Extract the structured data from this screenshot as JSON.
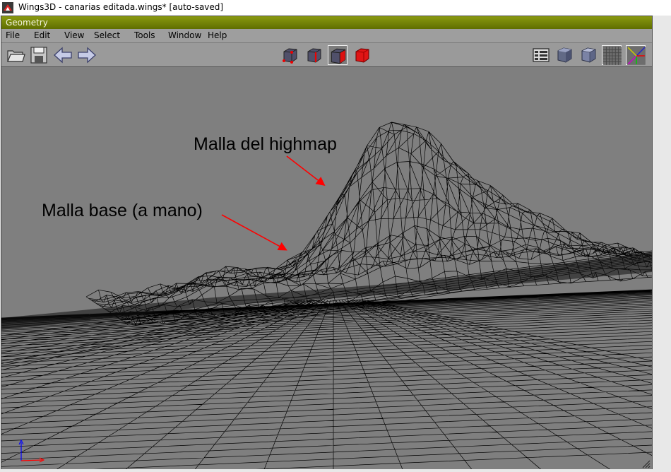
{
  "window": {
    "title": "Wings3D - canarias editada.wings* [auto-saved]",
    "app_icon": "wings3d-app-icon"
  },
  "geometry": {
    "header": "Geometry",
    "menu": [
      "File",
      "Edit",
      "View",
      "Select",
      "Tools",
      "Window",
      "Help"
    ],
    "toolbar_left": [
      "open-file-icon",
      "save-file-icon",
      "undo-arrow-icon",
      "redo-arrow-icon"
    ],
    "selection_modes": [
      "vertex-select-icon",
      "edge-select-icon",
      "face-select-icon",
      "body-select-icon"
    ],
    "active_selection_mode": "face-select-icon",
    "toolbar_right": [
      "outliner-icon",
      "smooth-shaded-icon",
      "flat-shaded-icon",
      "ground-grid-icon",
      "axes-toggle-icon"
    ]
  },
  "viewport": {
    "annotations": {
      "highmap_label": "Malla del highmap",
      "base_label": "Malla base (a mano)"
    },
    "colors": {
      "background": "#7f7f7f",
      "wire": "#000000",
      "arrow": "#ff0000",
      "axis_x": "#ff0000",
      "axis_y": "#0000ff"
    }
  }
}
